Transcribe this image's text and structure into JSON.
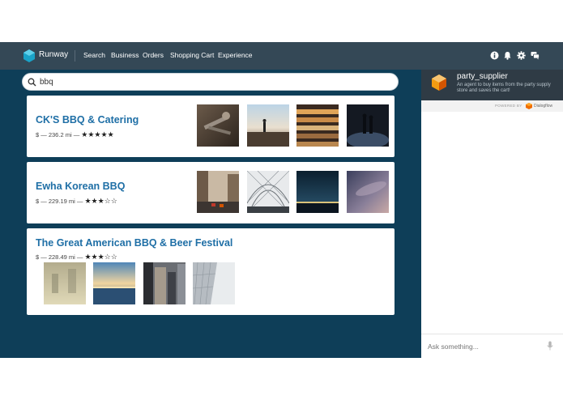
{
  "nav": {
    "brand": "Runway",
    "items": [
      "Search",
      "Business",
      "Orders",
      "Shopping Cart",
      "Experience"
    ],
    "icons": [
      "info-icon",
      "bell-icon",
      "gear-icon",
      "chat-icon"
    ],
    "brand_color": "#1aa3c8"
  },
  "search": {
    "query": "bbq"
  },
  "results": [
    {
      "title": "CK'S BBQ & Catering",
      "price": "$",
      "distance": "236.2 mi",
      "rating": 5,
      "stars": "★★★★★",
      "photos": [
        "tools",
        "pier",
        "steps",
        "night-walk"
      ]
    },
    {
      "title": "Ewha Korean BBQ",
      "price": "$",
      "distance": "229.19 mi",
      "rating": 3,
      "stars": "★★★☆☆",
      "photos": [
        "street",
        "dome",
        "night-sky",
        "clouds"
      ]
    },
    {
      "title": "The Great American BBQ & Beer Festival",
      "price": "$",
      "distance": "228.49 mi",
      "rating": 3,
      "stars": "★★★☆☆",
      "photos": [
        "fog",
        "sunset",
        "buildings",
        "facade"
      ]
    }
  ],
  "chat": {
    "agent_name": "party_supplier",
    "agent_description": "An agent to buy items from the party supply store and saves the cart!",
    "powered_by": "POWERED BY",
    "powered_name": "Dialogflow",
    "input_placeholder": "Ask something..."
  }
}
